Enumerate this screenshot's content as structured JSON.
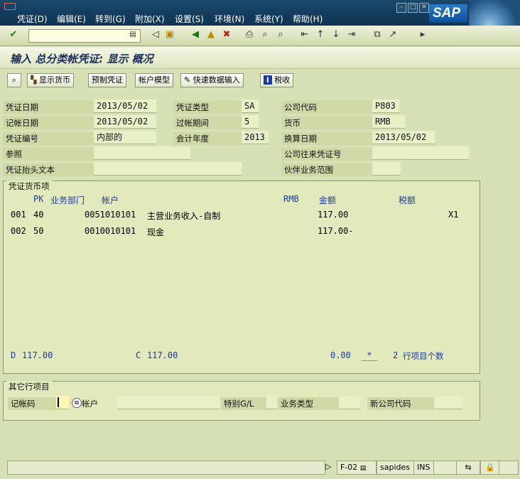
{
  "menu": [
    "凭证(D)",
    "编辑(E)",
    "转到(G)",
    "附加(X)",
    "设置(S)",
    "环境(N)",
    "系统(Y)",
    "帮助(H)"
  ],
  "logo": "SAP",
  "title": "输入 总分类帐凭证: 显示 概况",
  "app_toolbar": {
    "display_currency": "显示货币",
    "park_doc": "预制凭证",
    "acct_model": "帐户模型",
    "fast_entry": "快速数据输入",
    "tax": "税收"
  },
  "header": {
    "doc_date_label": "凭证日期",
    "doc_date": "2013/05/02",
    "post_date_label": "记帐日期",
    "post_date": "2013/05/02",
    "doc_no_label": "凭证编号",
    "doc_no": "内部的",
    "ref_label": "参照",
    "ref": "",
    "header_text_label": "凭证抬头文本",
    "header_text": "",
    "doc_type_label": "凭证类型",
    "doc_type": "SA",
    "period_label": "过帐期间",
    "period": "5",
    "fiscal_year_label": "会计年度",
    "fiscal_year": "2013",
    "company_label": "公司代码",
    "company": "P803",
    "currency_label": "货币",
    "currency": "RMB",
    "trans_date_label": "换算日期",
    "trans_date": "2013/05/02",
    "ic_doc_label": "公司往来凭证号",
    "ic_doc": "",
    "partner_label": "伙伴业务范围",
    "partner": ""
  },
  "items_group": {
    "title": "凭证货币项",
    "col_pk": "PK",
    "col_ba": "业务部门",
    "col_acct": "帐户",
    "col_cur": "RMB",
    "col_amount": "金额",
    "col_tax": "税额",
    "rows": [
      {
        "no": "001",
        "pk": "40",
        "acct": "0051010101",
        "name": "主营业务收入-自制",
        "amount": "117.00",
        "tax": "X1"
      },
      {
        "no": "002",
        "pk": "50",
        "acct": "0010010101",
        "name": "现金",
        "amount": "117.00-",
        "tax": ""
      }
    ],
    "debit_label": "D",
    "debit": "117.00",
    "credit_label": "C",
    "credit": "117.00",
    "balance": "0.00",
    "star": "*",
    "count": "2",
    "count_label": "行项目个数"
  },
  "other_group": {
    "title": "其它行项目",
    "post_key_label": "记帐码",
    "account_label": "帐户",
    "special_gl_label": "特别G/L",
    "trans_type_label": "业务类型",
    "new_company_label": "新公司代码"
  },
  "status": {
    "tcode": "F-02",
    "user": "sapides",
    "mode": "INS"
  }
}
